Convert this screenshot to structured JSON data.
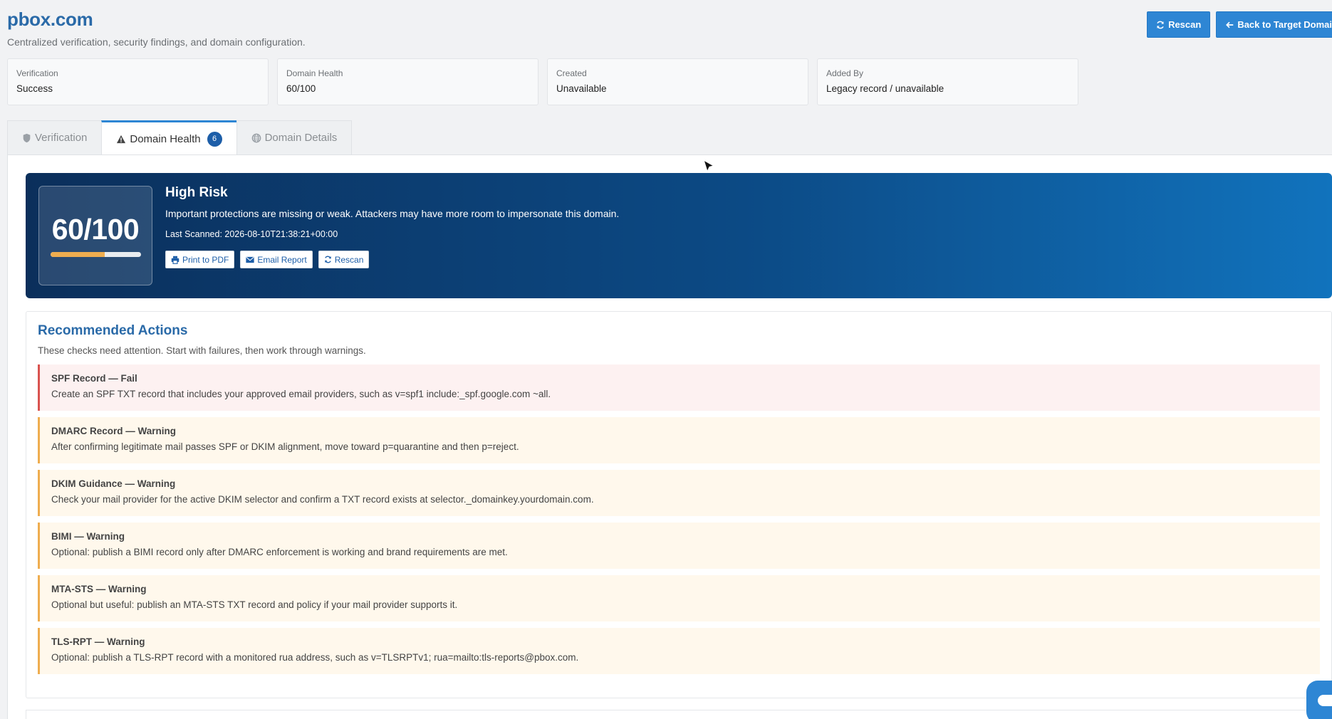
{
  "header": {
    "title": "pbox.com",
    "subtitle": "Centralized verification, security findings, and domain configuration."
  },
  "top_buttons": {
    "rescan_label": "Rescan",
    "back_label": "Back to Target Domai"
  },
  "stats": [
    {
      "label": "Verification",
      "value": "Success"
    },
    {
      "label": "Domain Health",
      "value": "60/100"
    },
    {
      "label": "Created",
      "value": "Unavailable"
    },
    {
      "label": "Added By",
      "value": "Legacy record / unavailable"
    }
  ],
  "tabs": [
    {
      "label": "Verification",
      "icon": "shield-icon"
    },
    {
      "label": "Domain Health",
      "icon": "warning-icon",
      "badge": "6",
      "active": true
    },
    {
      "label": "Domain Details",
      "icon": "globe-icon"
    }
  ],
  "hero": {
    "score_text": "60/100",
    "score_fraction": 0.6,
    "risk_title": "High Risk",
    "risk_desc": "Important protections are missing or weak. Attackers may have more room to impersonate this domain.",
    "last_scanned": "Last Scanned: 2026-08-10T21:38:21+00:00",
    "buttons": {
      "print": "Print to PDF",
      "email": "Email Report",
      "rescan": "Rescan"
    }
  },
  "recommended": {
    "title": "Recommended Actions",
    "subtitle": "These checks need attention. Start with failures, then work through warnings.",
    "items": [
      {
        "title": "SPF Record — Fail",
        "desc": "Create an SPF TXT record that includes your approved email providers, such as v=spf1 include:_spf.google.com ~all.",
        "status": "fail"
      },
      {
        "title": "DMARC Record — Warning",
        "desc": "After confirming legitimate mail passes SPF or DKIM alignment, move toward p=quarantine and then p=reject.",
        "status": "warning"
      },
      {
        "title": "DKIM Guidance — Warning",
        "desc": "Check your mail provider for the active DKIM selector and confirm a TXT record exists at selector._domainkey.yourdomain.com.",
        "status": "warning"
      },
      {
        "title": "BIMI — Warning",
        "desc": "Optional: publish a BIMI record only after DMARC enforcement is working and brand requirements are met.",
        "status": "warning"
      },
      {
        "title": "MTA-STS — Warning",
        "desc": "Optional but useful: publish an MTA-STS TXT record and policy if your mail provider supports it.",
        "status": "warning"
      },
      {
        "title": "TLS-RPT — Warning",
        "desc": "Optional: publish a TLS-RPT record with a monitored rua address, such as v=TLSRPTv1; rua=mailto:tls-reports@pbox.com.",
        "status": "warning"
      }
    ]
  },
  "colors": {
    "accent": "#2e86d4",
    "title_blue": "#2a6aa8",
    "warning": "#efad4f",
    "fail": "#d9534f"
  }
}
